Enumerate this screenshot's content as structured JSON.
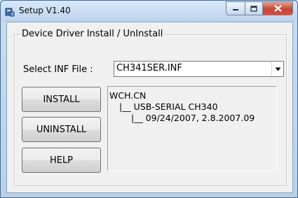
{
  "window": {
    "title": "Setup V1.40"
  },
  "group": {
    "title": "Device Driver Install / UnInstall"
  },
  "inf": {
    "label": "Select INF File :",
    "selected": "CH341SER.INF"
  },
  "buttons": {
    "install": "INSTALL",
    "uninstall": "UNINSTALL",
    "help": "HELP"
  },
  "info_lines": [
    "WCH.CN",
    "|__ USB-SERIAL CH340",
    "|__ 09/24/2007, 2.8.2007.09"
  ],
  "icons": {
    "app": "setup-app-icon",
    "minimize": "minimize-icon",
    "maximize": "maximize-icon",
    "close": "close-icon",
    "dropdown": "chevron-down-icon"
  }
}
